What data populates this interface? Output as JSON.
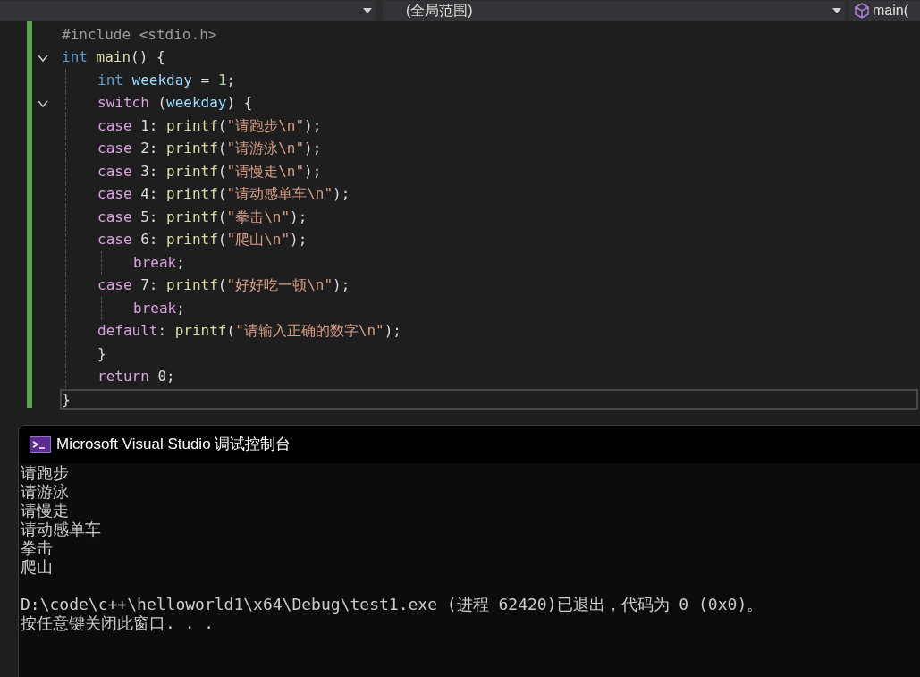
{
  "toolbar": {
    "dropdowns": [
      {
        "kind": "blank"
      },
      {
        "kind": "text",
        "label": "(全局范围)"
      },
      {
        "kind": "symbol",
        "label": "main("
      }
    ]
  },
  "editor": {
    "lines": [
      {
        "tokens": [
          {
            "text": "#include <stdio.h>",
            "kind": "preproc"
          }
        ]
      },
      {
        "expanded": true,
        "tokens": [
          {
            "text": "int ",
            "kind": "type"
          },
          {
            "text": "main",
            "kind": "func"
          },
          {
            "text": "() {",
            "kind": "plain"
          }
        ],
        "children": [
          {
            "tokens": [
              {
                "text": "int ",
                "kind": "type"
              },
              {
                "text": "weekday",
                "kind": "ident"
              },
              {
                "text": " = ",
                "kind": "plain"
              },
              {
                "text": "1",
                "kind": "number"
              },
              {
                "text": ";",
                "kind": "plain"
              }
            ]
          },
          {
            "expanded": true,
            "tokens": [
              {
                "text": "switch",
                "kind": "control"
              },
              {
                "text": " (",
                "kind": "plain"
              },
              {
                "text": "weekday",
                "kind": "ident"
              },
              {
                "text": ") {",
                "kind": "plain"
              }
            ]
          },
          {
            "tokens": [
              {
                "text": "case",
                "kind": "control"
              },
              {
                "text": " 1: ",
                "kind": "plain"
              },
              {
                "text": "printf",
                "kind": "func"
              },
              {
                "text": "(",
                "kind": "plain"
              },
              {
                "text": "\"请跑步\\n\"",
                "kind": "string"
              },
              {
                "text": ");",
                "kind": "plain"
              }
            ]
          },
          {
            "tokens": [
              {
                "text": "case",
                "kind": "control"
              },
              {
                "text": " 2: ",
                "kind": "plain"
              },
              {
                "text": "printf",
                "kind": "func"
              },
              {
                "text": "(",
                "kind": "plain"
              },
              {
                "text": "\"请游泳\\n\"",
                "kind": "string"
              },
              {
                "text": ");",
                "kind": "plain"
              }
            ]
          },
          {
            "tokens": [
              {
                "text": "case",
                "kind": "control"
              },
              {
                "text": " 3: ",
                "kind": "plain"
              },
              {
                "text": "printf",
                "kind": "func"
              },
              {
                "text": "(",
                "kind": "plain"
              },
              {
                "text": "\"请慢走\\n\"",
                "kind": "string"
              },
              {
                "text": ");",
                "kind": "plain"
              }
            ]
          },
          {
            "tokens": [
              {
                "text": "case",
                "kind": "control"
              },
              {
                "text": " 4: ",
                "kind": "plain"
              },
              {
                "text": "printf",
                "kind": "func"
              },
              {
                "text": "(",
                "kind": "plain"
              },
              {
                "text": "\"请动感单车\\n\"",
                "kind": "string"
              },
              {
                "text": ");",
                "kind": "plain"
              }
            ]
          },
          {
            "tokens": [
              {
                "text": "case",
                "kind": "control"
              },
              {
                "text": " 5: ",
                "kind": "plain"
              },
              {
                "text": "printf",
                "kind": "func"
              },
              {
                "text": "(",
                "kind": "plain"
              },
              {
                "text": "\"拳击\\n\"",
                "kind": "string"
              },
              {
                "text": ");",
                "kind": "plain"
              }
            ]
          },
          {
            "tokens": [
              {
                "text": "case",
                "kind": "control"
              },
              {
                "text": " 6: ",
                "kind": "plain"
              },
              {
                "text": "printf",
                "kind": "func"
              },
              {
                "text": "(",
                "kind": "plain"
              },
              {
                "text": "\"爬山\\n\"",
                "kind": "string"
              },
              {
                "text": ");",
                "kind": "plain"
              }
            ],
            "children": [
              {
                "tokens": [
                  {
                    "text": "break",
                    "kind": "control"
                  },
                  {
                    "text": ";",
                    "kind": "plain"
                  }
                ]
              }
            ]
          },
          {
            "tokens": [
              {
                "text": "case",
                "kind": "control"
              },
              {
                "text": " 7: ",
                "kind": "plain"
              },
              {
                "text": "printf",
                "kind": "func"
              },
              {
                "text": "(",
                "kind": "plain"
              },
              {
                "text": "\"好好吃一顿\\n\"",
                "kind": "string"
              },
              {
                "text": ");",
                "kind": "plain"
              }
            ],
            "children": [
              {
                "tokens": [
                  {
                    "text": "break",
                    "kind": "control"
                  },
                  {
                    "text": ";",
                    "kind": "plain"
                  }
                ]
              }
            ]
          },
          {
            "tokens": [
              {
                "text": "default",
                "kind": "control"
              },
              {
                "text": ": ",
                "kind": "plain"
              },
              {
                "text": "printf",
                "kind": "func"
              },
              {
                "text": "(",
                "kind": "plain"
              },
              {
                "text": "\"请输入正确的数字\\n\"",
                "kind": "string"
              },
              {
                "text": ");",
                "kind": "plain"
              }
            ]
          },
          {
            "tokens": [
              {
                "text": "}",
                "kind": "plain"
              }
            ]
          },
          {
            "tokens": [
              {
                "text": "return",
                "kind": "control"
              },
              {
                "text": " 0;",
                "kind": "plain"
              }
            ]
          }
        ]
      },
      {
        "current": true,
        "tokens": [
          {
            "text": "}",
            "kind": "plain"
          }
        ]
      }
    ]
  },
  "console": {
    "title": "Microsoft Visual Studio 调试控制台",
    "output": [
      "请跑步",
      "请游泳",
      "请慢走",
      "请动感单车",
      "拳击",
      "爬山"
    ],
    "exit_message": [
      "D:\\code\\c++\\helloworld1\\x64\\Debug\\test1.exe (进程 62420)已退出，代码为 0 (0x0)。",
      "按任意键关闭此窗口. . ."
    ]
  }
}
